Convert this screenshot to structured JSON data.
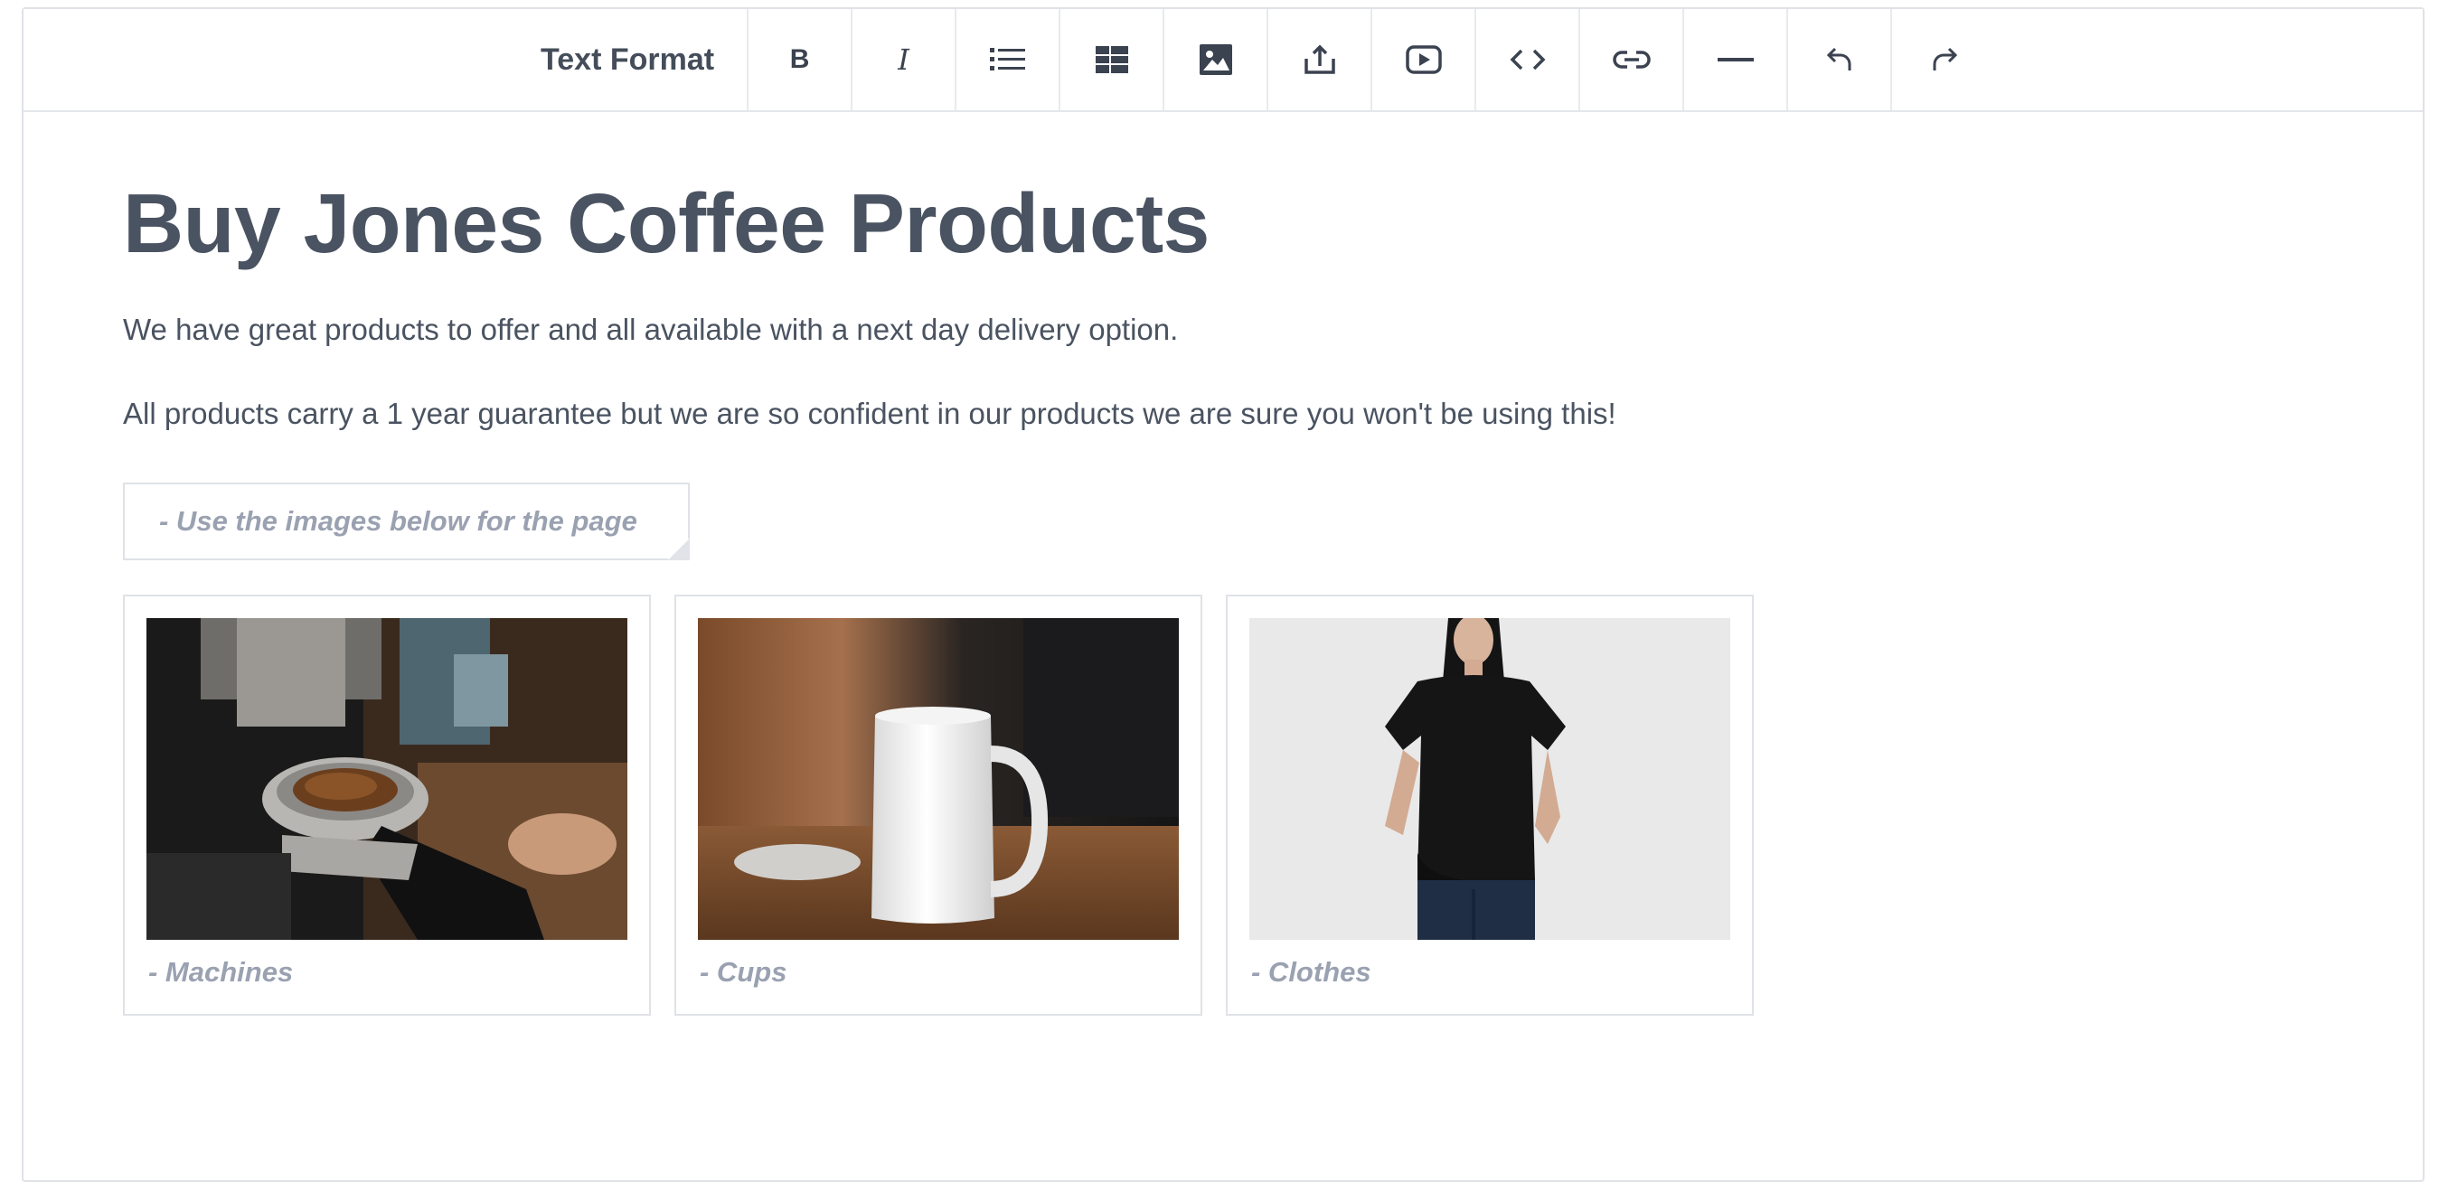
{
  "toolbar": {
    "format_label": "Text Format",
    "buttons": [
      {
        "name": "bold-button",
        "icon": "bold-icon",
        "glyph": "B"
      },
      {
        "name": "italic-button",
        "icon": "italic-icon",
        "glyph": "I"
      },
      {
        "name": "list-button",
        "icon": "list-icon"
      },
      {
        "name": "table-button",
        "icon": "table-icon"
      },
      {
        "name": "image-button",
        "icon": "image-icon"
      },
      {
        "name": "upload-button",
        "icon": "upload-icon"
      },
      {
        "name": "video-button",
        "icon": "video-icon"
      },
      {
        "name": "code-button",
        "icon": "code-icon"
      },
      {
        "name": "link-button",
        "icon": "link-icon"
      },
      {
        "name": "horizontal-rule-button",
        "icon": "horizontal-rule-icon"
      },
      {
        "name": "undo-button",
        "icon": "undo-icon"
      },
      {
        "name": "redo-button",
        "icon": "redo-icon"
      }
    ]
  },
  "content": {
    "heading": "Buy Jones Coffee Products",
    "paragraph1": "We have great products to offer and all available with a next day delivery option.",
    "paragraph2": "All products carry a 1 year guarantee but we are so confident in our products we are sure you won't be using this!",
    "note": "- Use the images below for the page"
  },
  "gallery": [
    {
      "caption": "- Machines",
      "image": "coffee-machine-photo"
    },
    {
      "caption": "- Cups",
      "image": "white-mug-photo"
    },
    {
      "caption": "- Clothes",
      "image": "black-tshirt-photo"
    }
  ],
  "colors": {
    "text": "#4a5361",
    "muted": "#9aa1b1",
    "border": "#dfe2e6"
  }
}
